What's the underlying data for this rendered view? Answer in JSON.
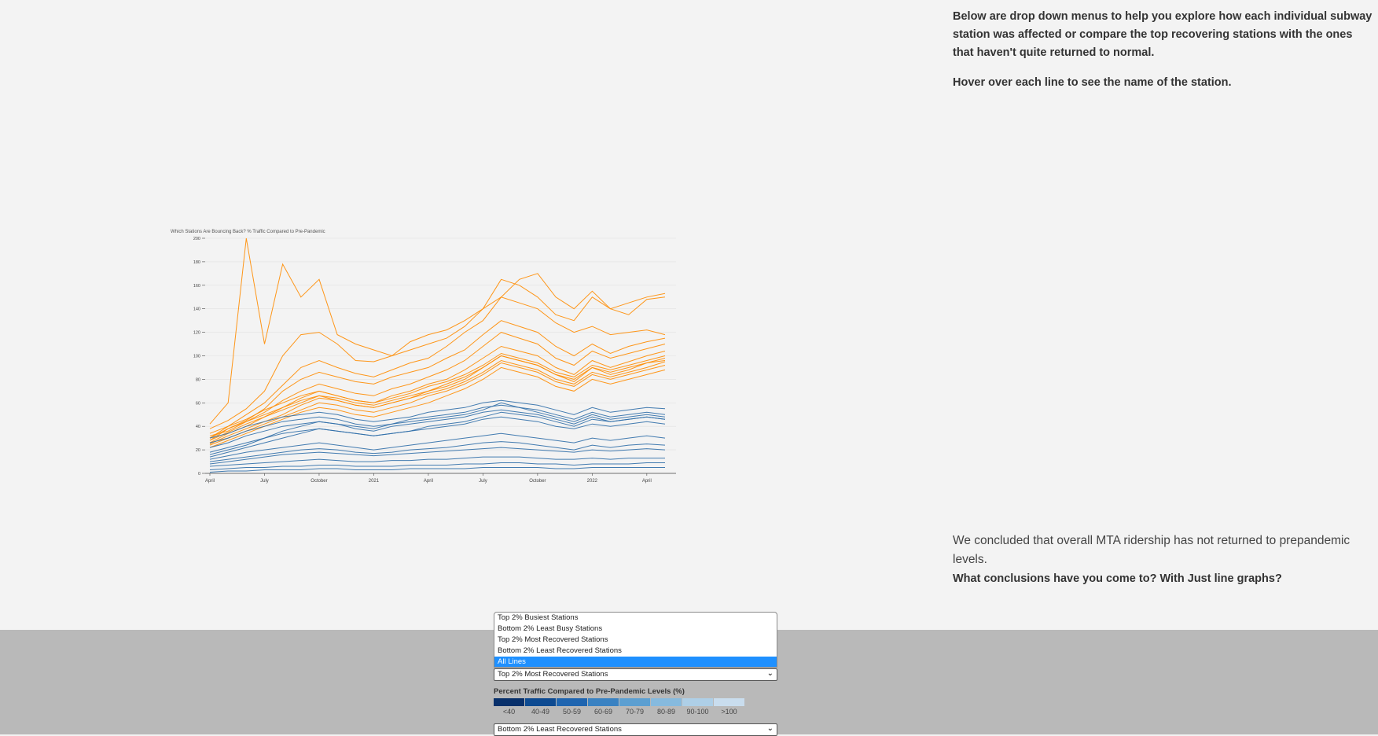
{
  "intro": {
    "paragraph1": "Below are drop down menus to help you explore how each individual subway station was affected or compare the top recovering stations with the ones that haven't quite returned to normal.",
    "paragraph2": "Hover over each line to see the name of the station."
  },
  "conclusion": {
    "line1": "We concluded that overall MTA ridership has not returned to prepandemic levels.",
    "question": "What conclusions have you come to? With Just line graphs?"
  },
  "dropdown": {
    "options": [
      "Top 2% Busiest Stations",
      "Bottom 2% Least Busy Stations",
      "Top 2% Most Recovered Stations",
      "Bottom 2% Least Recovered Stations",
      "All Lines"
    ],
    "highlighted": "All Lines",
    "selected_value": "Top 2% Most Recovered Stations"
  },
  "second_select": {
    "selected_value": "Bottom 2% Least Recovered Stations"
  },
  "legend": {
    "title": "Percent Traffic Compared to Pre-Pandemic Levels (%)",
    "items": [
      {
        "label": "<40",
        "color": "#08306b"
      },
      {
        "label": "40-49",
        "color": "#0d4a91"
      },
      {
        "label": "50-59",
        "color": "#1f65b0"
      },
      {
        "label": "60-69",
        "color": "#3a82c2"
      },
      {
        "label": "70-79",
        "color": "#5c9fd1"
      },
      {
        "label": "80-89",
        "color": "#86bade"
      },
      {
        "label": "90-100",
        "color": "#aecfe7"
      },
      {
        "label": ">100",
        "color": "#c9ddee"
      }
    ]
  },
  "colors": {
    "recovered_series": "#ff8c00",
    "least_recovered_series": "#2f6ea8",
    "highlight": "#1e90ff",
    "footer_band": "#b9b9b9"
  },
  "chart_data": {
    "type": "line",
    "title": "Which Stations Are Bouncing Back? % Traffic Compared to Pre-Pandemic",
    "xlabel": "",
    "ylabel": "",
    "ylim": [
      0,
      200
    ],
    "y_ticks": [
      0,
      20,
      40,
      60,
      80,
      100,
      120,
      140,
      160,
      180,
      200
    ],
    "x_tick_labels": [
      "April",
      "July",
      "October",
      "2021",
      "April",
      "July",
      "October",
      "2022",
      "April"
    ],
    "grid": true,
    "x_dates": [
      "2020-04",
      "2020-05",
      "2020-06",
      "2020-07",
      "2020-08",
      "2020-09",
      "2020-10",
      "2020-11",
      "2020-12",
      "2021-01",
      "2021-02",
      "2021-03",
      "2021-04",
      "2021-05",
      "2021-06",
      "2021-07",
      "2021-08",
      "2021-09",
      "2021-10",
      "2021-11",
      "2021-12",
      "2022-01",
      "2022-02",
      "2022-03",
      "2022-04",
      "2022-05"
    ],
    "series_groups": [
      {
        "group": "Top 2% Most Recovered Stations",
        "color": "#ff8c00",
        "series": [
          {
            "values": [
              42,
              60,
              200,
              110,
              178,
              150,
              165,
              118,
              110,
              105,
              100,
              112,
              118,
              122,
              130,
              140,
              150,
              165,
              170,
              150,
              140,
              155,
              140,
              145,
              150,
              153
            ]
          },
          {
            "values": [
              38,
              45,
              55,
              70,
              100,
              118,
              120,
              110,
              96,
              95,
              100,
              105,
              110,
              115,
              125,
              140,
              165,
              160,
              150,
              135,
              130,
              150,
              140,
              135,
              148,
              150
            ]
          },
          {
            "values": [
              30,
              40,
              50,
              60,
              75,
              90,
              96,
              90,
              85,
              82,
              88,
              94,
              98,
              108,
              120,
              130,
              150,
              145,
              140,
              128,
              120,
              125,
              118,
              120,
              122,
              118
            ]
          },
          {
            "values": [
              28,
              38,
              45,
              55,
              70,
              80,
              86,
              82,
              78,
              76,
              82,
              86,
              90,
              98,
              105,
              118,
              130,
              125,
              120,
              108,
              100,
              110,
              102,
              108,
              112,
              115
            ]
          },
          {
            "values": [
              32,
              36,
              44,
              52,
              62,
              70,
              76,
              72,
              68,
              66,
              72,
              76,
              82,
              88,
              96,
              108,
              120,
              115,
              110,
              98,
              92,
              104,
              98,
              102,
              106,
              110
            ]
          },
          {
            "values": [
              26,
              34,
              40,
              48,
              56,
              64,
              70,
              66,
              62,
              60,
              66,
              70,
              76,
              80,
              88,
              98,
              108,
              104,
              100,
              90,
              84,
              96,
              90,
              95,
              100,
              104
            ]
          },
          {
            "values": [
              25,
              32,
              38,
              44,
              50,
              58,
              64,
              62,
              58,
              56,
              60,
              64,
              70,
              74,
              80,
              90,
              100,
              96,
              92,
              84,
              78,
              90,
              84,
              88,
              94,
              98
            ]
          },
          {
            "values": [
              24,
              30,
              36,
              42,
              48,
              54,
              60,
              58,
              54,
              52,
              56,
              60,
              66,
              70,
              76,
              84,
              94,
              90,
              86,
              78,
              74,
              84,
              80,
              84,
              88,
              92
            ]
          },
          {
            "values": [
              22,
              28,
              34,
              40,
              46,
              52,
              56,
              54,
              50,
              48,
              52,
              56,
              60,
              66,
              72,
              80,
              90,
              86,
              82,
              74,
              70,
              80,
              76,
              80,
              84,
              88
            ]
          },
          {
            "values": [
              30,
              38,
              44,
              50,
              56,
              62,
              66,
              62,
              58,
              56,
              60,
              64,
              68,
              72,
              78,
              86,
              96,
              92,
              88,
              80,
              76,
              86,
              82,
              86,
              90,
              95
            ]
          },
          {
            "values": [
              34,
              40,
              46,
              54,
              60,
              66,
              70,
              66,
              62,
              60,
              64,
              68,
              74,
              78,
              84,
              92,
              102,
              98,
              94,
              86,
              82,
              92,
              88,
              92,
              96,
              100
            ]
          },
          {
            "values": [
              28,
              35,
              42,
              48,
              54,
              60,
              66,
              64,
              60,
              58,
              62,
              66,
              70,
              76,
              82,
              90,
              100,
              96,
              92,
              84,
              80,
              90,
              86,
              90,
              94,
              96
            ]
          }
        ]
      },
      {
        "group": "Bottom 2% Least Recovered Stations",
        "color": "#2f6ea8",
        "series": [
          {
            "values": [
              30,
              34,
              40,
              44,
              48,
              50,
              52,
              50,
              46,
              44,
              46,
              48,
              52,
              54,
              56,
              60,
              62,
              60,
              58,
              54,
              50,
              56,
              52,
              54,
              56,
              55
            ]
          },
          {
            "values": [
              26,
              30,
              36,
              40,
              44,
              46,
              48,
              46,
              42,
              40,
              42,
              46,
              48,
              50,
              52,
              56,
              58,
              56,
              54,
              50,
              46,
              52,
              48,
              50,
              52,
              50
            ]
          },
          {
            "values": [
              22,
              26,
              32,
              36,
              40,
              42,
              44,
              42,
              38,
              36,
              40,
              42,
              44,
              46,
              48,
              52,
              54,
              52,
              50,
              46,
              42,
              48,
              44,
              46,
              48,
              46
            ]
          },
          {
            "values": [
              18,
              22,
              26,
              30,
              34,
              36,
              38,
              36,
              34,
              32,
              34,
              36,
              38,
              40,
              42,
              46,
              48,
              46,
              44,
              40,
              38,
              42,
              40,
              42,
              44,
              42
            ]
          },
          {
            "values": [
              12,
              15,
              18,
              20,
              22,
              24,
              26,
              24,
              22,
              20,
              22,
              24,
              26,
              28,
              30,
              32,
              34,
              32,
              30,
              28,
              26,
              30,
              28,
              30,
              32,
              30
            ]
          },
          {
            "values": [
              10,
              12,
              14,
              16,
              18,
              20,
              21,
              20,
              18,
              17,
              18,
              20,
              21,
              22,
              24,
              26,
              27,
              26,
              24,
              22,
              20,
              24,
              22,
              24,
              25,
              24
            ]
          },
          {
            "values": [
              8,
              10,
              12,
              14,
              16,
              17,
              18,
              17,
              16,
              15,
              16,
              17,
              18,
              19,
              20,
              21,
              22,
              21,
              20,
              19,
              18,
              20,
              19,
              20,
              21,
              20
            ]
          },
          {
            "values": [
              6,
              7,
              8,
              9,
              10,
              11,
              12,
              11,
              10,
              10,
              11,
              11,
              12,
              12,
              13,
              14,
              14,
              14,
              13,
              12,
              12,
              13,
              12,
              13,
              13,
              13
            ]
          },
          {
            "values": [
              3,
              4,
              5,
              5,
              6,
              6,
              7,
              7,
              6,
              6,
              6,
              7,
              7,
              7,
              8,
              8,
              9,
              9,
              8,
              8,
              7,
              8,
              8,
              8,
              9,
              9
            ]
          },
          {
            "values": [
              1,
              2,
              2,
              3,
              3,
              3,
              4,
              4,
              3,
              3,
              3,
              4,
              4,
              4,
              4,
              5,
              5,
              5,
              5,
              4,
              4,
              5,
              5,
              5,
              5,
              5
            ]
          },
          {
            "values": [
              16,
              20,
              24,
              30,
              36,
              40,
              44,
              42,
              40,
              38,
              42,
              44,
              46,
              48,
              50,
              54,
              60,
              56,
              52,
              48,
              44,
              50,
              46,
              48,
              50,
              48
            ]
          },
          {
            "values": [
              14,
              18,
              22,
              26,
              30,
              34,
              38,
              36,
              34,
              32,
              34,
              36,
              40,
              42,
              44,
              48,
              52,
              50,
              48,
              44,
              40,
              46,
              44,
              46,
              48,
              46
            ]
          }
        ]
      }
    ]
  }
}
